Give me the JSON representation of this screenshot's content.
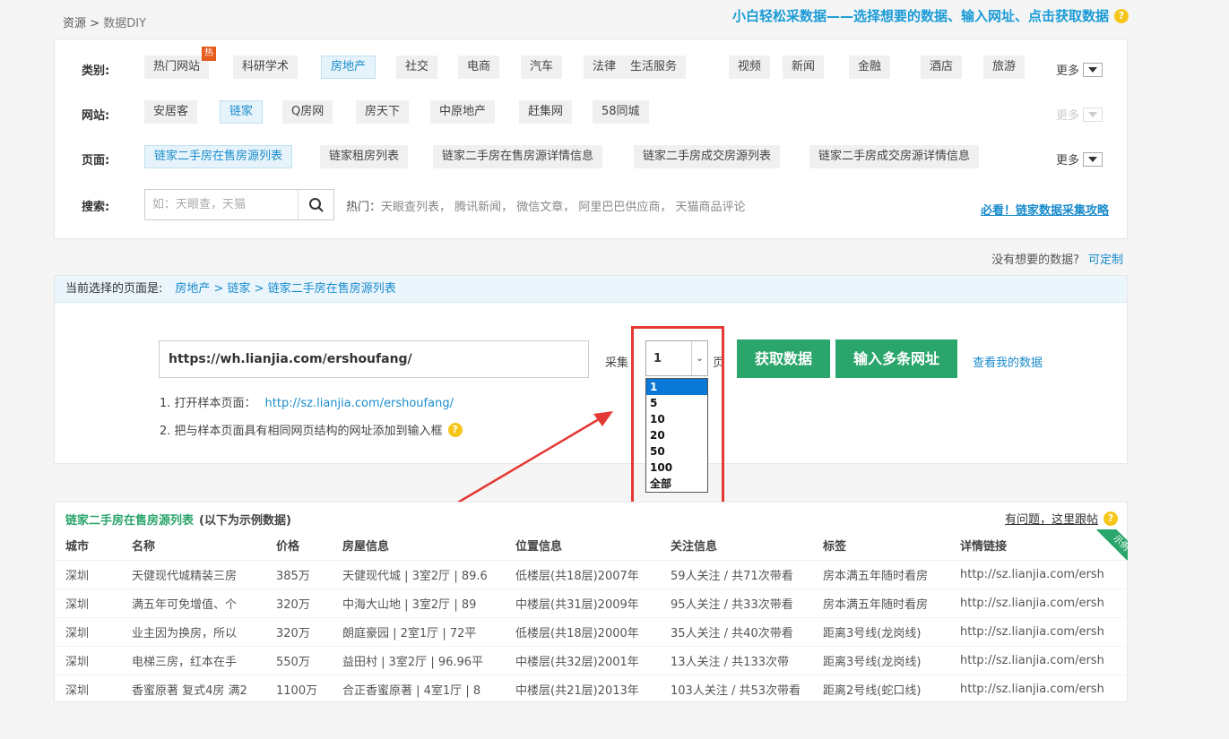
{
  "breadcrumb": {
    "root": "资源",
    "sep": ">",
    "current": "数据DIY"
  },
  "slogan": "小白轻松采数据——选择想要的数据、输入网址、点击获取数据",
  "help_glyph": "?",
  "filter": {
    "category_label": "类别:",
    "categories": [
      "热门网站",
      "科研学术",
      "房地产",
      "社交",
      "电商",
      "汽车",
      "法律",
      "生活服务",
      "视频",
      "新闻",
      "金融",
      "酒店",
      "旅游"
    ],
    "active_category": "房地产",
    "hot_badge": "热",
    "site_label": "网站:",
    "sites": [
      "安居客",
      "链家",
      "Q房网",
      "房天下",
      "中原地产",
      "赶集网",
      "58同城"
    ],
    "active_site": "链家",
    "page_label": "页面:",
    "pages": [
      "链家二手房在售房源列表",
      "链家租房列表",
      "链家二手房在售房源详情信息",
      "链家二手房成交房源列表",
      "链家二手房成交房源详情信息"
    ],
    "active_page": "链家二手房在售房源列表",
    "more": "更多",
    "search_label": "搜索:",
    "search_placeholder": "如：天眼查，天猫",
    "hot_label": "热门：",
    "hot_items": "天眼查列表， 腾讯新闻， 微信文章， 阿里巴巴供应商， 天猫商品评论",
    "guide_link": "必看！链家数据采集攻略"
  },
  "custom": {
    "question": "没有想要的数据?",
    "link": "可定制"
  },
  "current": {
    "label": "当前选择的页面是:",
    "path": "房地产 > 链家 > 链家二手房在售房源列表",
    "url_value": "https://wh.lianjia.com/ershoufang/",
    "collect_label": "采集",
    "pages_value": "1",
    "page_unit": "页",
    "fetch_button": "获取数据",
    "multi_url_button": "输入多条网址",
    "my_data_link": "查看我的数据",
    "step1": "1. 打开样本页面：",
    "step1_link": "http://sz.lianjia.com/ershoufang/",
    "step2": "2. 把与样本页面具有相同网页结构的网址添加到输入框"
  },
  "dropdown": {
    "options": [
      "1",
      "5",
      "10",
      "20",
      "50",
      "100",
      "全部"
    ],
    "selected": "1"
  },
  "sample": {
    "title": "链家二手房在售房源列表",
    "subtitle": "(以下为示例数据)",
    "report": "有问题，这里跟帖",
    "ribbon": "示例",
    "columns": [
      "城市",
      "名称",
      "价格",
      "房屋信息",
      "位置信息",
      "关注信息",
      "标签",
      "详情链接"
    ],
    "rows": [
      [
        "深圳",
        "天健现代城精装三房",
        "385万",
        "天健现代城 | 3室2厅 | 89.6",
        "低楼层(共18层)2007年",
        "59人关注 / 共71次带看",
        "房本满五年随时看房",
        "http://sz.lianjia.com/ersh"
      ],
      [
        "深圳",
        "满五年可免增值、个",
        "320万",
        "中海大山地 | 3室2厅 | 89",
        "中楼层(共31层)2009年",
        "95人关注 / 共33次带看",
        "房本满五年随时看房",
        "http://sz.lianjia.com/ersh"
      ],
      [
        "深圳",
        "业主因为换房，所以",
        "320万",
        "朗庭豪园 | 2室1厅 | 72平",
        "低楼层(共18层)2000年",
        "35人关注 / 共40次带看",
        "距离3号线(龙岗线)",
        "http://sz.lianjia.com/ersh"
      ],
      [
        "深圳",
        "电梯三房，红本在手",
        "550万",
        "益田村 | 3室2厅 | 96.96平",
        "中楼层(共32层)2001年",
        "13人关注 / 共133次带",
        "距离3号线(龙岗线)",
        "http://sz.lianjia.com/ersh"
      ],
      [
        "深圳",
        "香蜜原著 复式4房 满2",
        "1100万",
        "合正香蜜原著 | 4室1厅 | 8",
        "中楼层(共21层)2013年",
        "103人关注 / 共53次带看",
        "距离2号线(蛇口线)",
        "http://sz.lianjia.com/ersh"
      ]
    ]
  },
  "colors": {
    "accent": "#1a8ccc",
    "green": "#2aa56b",
    "annotation": "#e53935"
  }
}
